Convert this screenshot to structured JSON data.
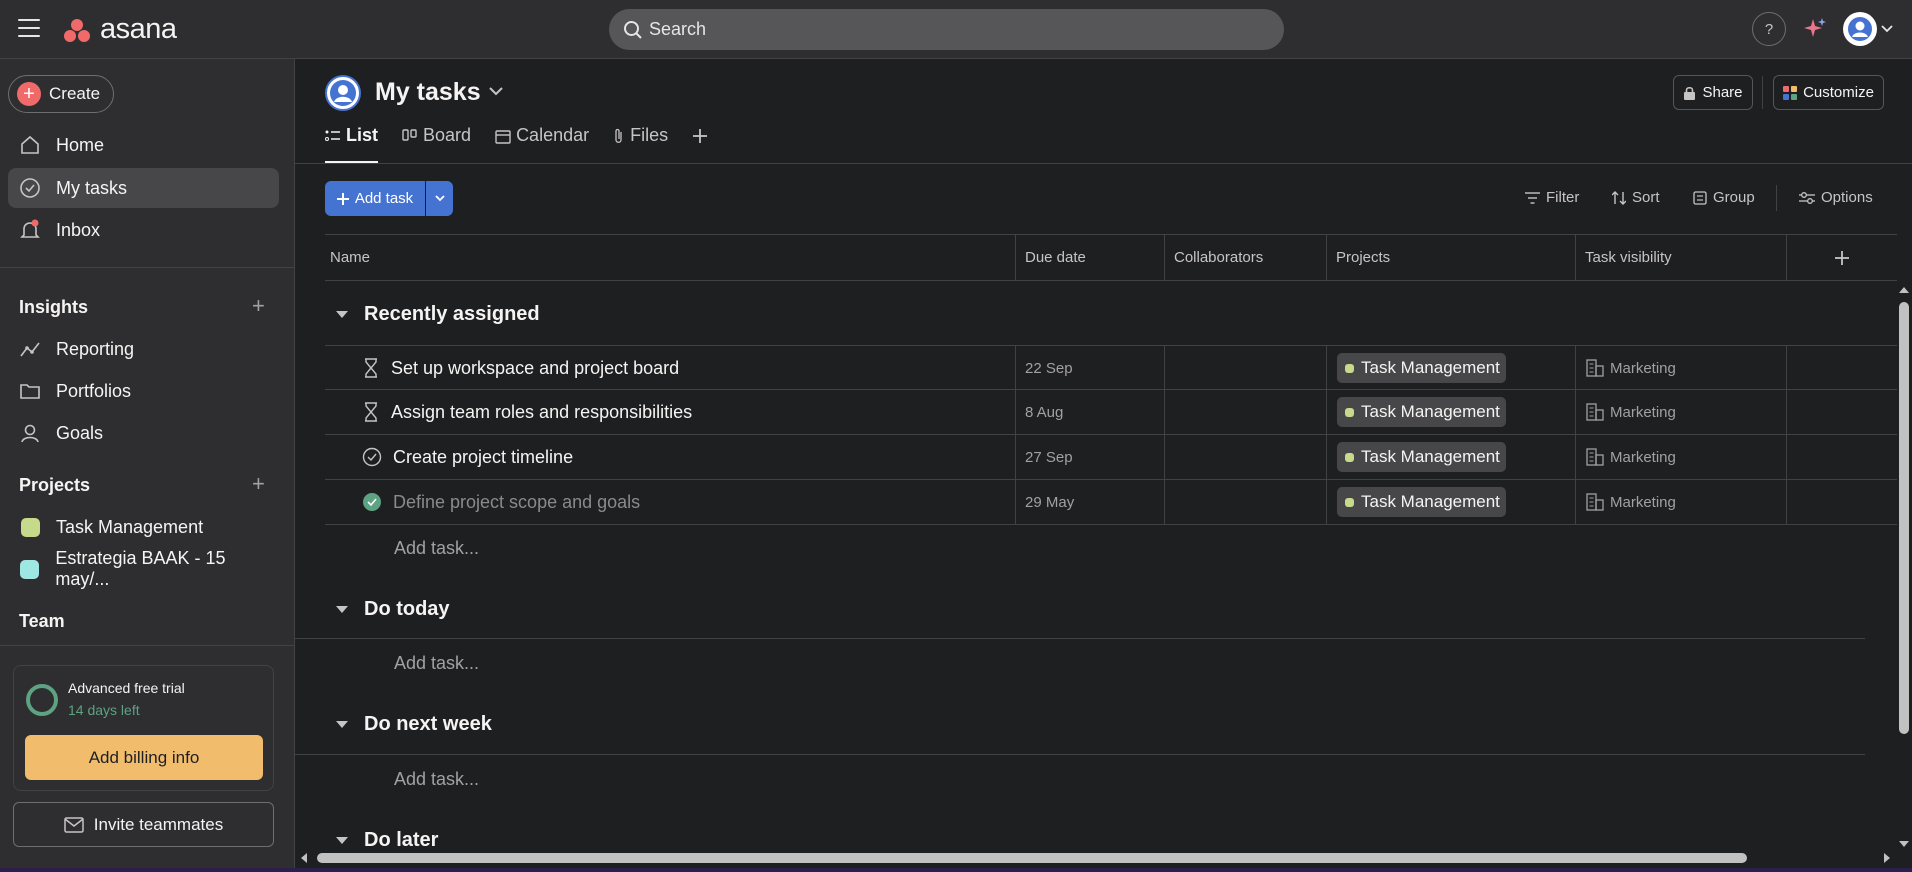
{
  "topbar": {
    "logo_text": "asana",
    "search_placeholder": "Search",
    "help_label": "?"
  },
  "sidebar": {
    "create_label": "Create",
    "nav": [
      {
        "label": "Home",
        "icon": "home-icon"
      },
      {
        "label": "My tasks",
        "icon": "check-circle-icon",
        "active": true
      },
      {
        "label": "Inbox",
        "icon": "bell-icon"
      }
    ],
    "insights": {
      "title": "Insights",
      "items": [
        {
          "label": "Reporting",
          "icon": "line-chart-icon"
        },
        {
          "label": "Portfolios",
          "icon": "folder-icon"
        },
        {
          "label": "Goals",
          "icon": "person-icon"
        }
      ]
    },
    "projects": {
      "title": "Projects",
      "items": [
        {
          "label": "Task Management",
          "color": "#c7d98a"
        },
        {
          "label": "Estrategia BAAK - 15 may/...",
          "color": "#9ee7e3"
        }
      ]
    },
    "team_title": "Team",
    "trial": {
      "title": "Advanced free trial",
      "subtitle": "14 days left",
      "billing_label": "Add billing info"
    },
    "invite_label": "Invite teammates"
  },
  "header": {
    "title": "My tasks",
    "share_label": "Share",
    "customize_label": "Customize",
    "tabs": [
      {
        "label": "List",
        "icon": "list-icon",
        "active": true
      },
      {
        "label": "Board",
        "icon": "board-icon"
      },
      {
        "label": "Calendar",
        "icon": "calendar-icon"
      },
      {
        "label": "Files",
        "icon": "paperclip-icon"
      }
    ]
  },
  "toolbar": {
    "add_task_label": "Add task",
    "filter_label": "Filter",
    "sort_label": "Sort",
    "group_label": "Group",
    "options_label": "Options"
  },
  "table": {
    "columns": [
      "Name",
      "Due date",
      "Collaborators",
      "Projects",
      "Task visibility"
    ],
    "add_task_placeholder": "Add task...",
    "sections": [
      {
        "title": "Recently assigned",
        "rows": [
          {
            "name": "Set up workspace and project board",
            "due": "22 Sep",
            "project": "Task Management",
            "visibility": "Marketing",
            "status": "waiting"
          },
          {
            "name": "Assign team roles and responsibilities",
            "due": "8 Aug",
            "project": "Task Management",
            "visibility": "Marketing",
            "status": "waiting"
          },
          {
            "name": "Create project timeline",
            "due": "27 Sep",
            "project": "Task Management",
            "visibility": "Marketing",
            "status": "open"
          },
          {
            "name": "Define project scope and goals",
            "due": "29 May",
            "project": "Task Management",
            "visibility": "Marketing",
            "status": "completed"
          }
        ]
      },
      {
        "title": "Do today",
        "rows": []
      },
      {
        "title": "Do next week",
        "rows": []
      },
      {
        "title": "Do later",
        "rows": []
      }
    ]
  },
  "colors": {
    "accent": "#4573d2",
    "brand": "#f06a6a",
    "billing": "#f1bd6c",
    "success": "#5da283"
  }
}
